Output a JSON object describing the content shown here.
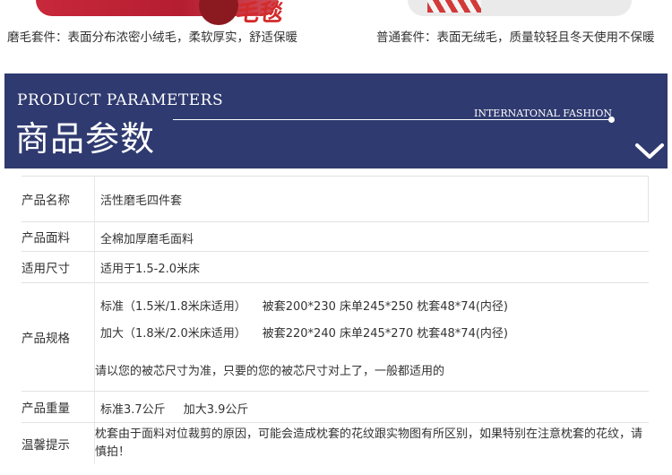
{
  "captions": {
    "left": "磨毛套件：表面分布浓密小绒毛，柔软厚实，舒适保暖",
    "right": "普通套件：表面无绒毛，质量较轻且冬天使用不保暖"
  },
  "banner": {
    "title_en": "PRODUCT PARAMETERS",
    "title_cn": "商品参数",
    "tag": "INTERNATONAL FASHION"
  },
  "params": [
    {
      "label": "产品名称",
      "value": "活性磨毛四件套"
    },
    {
      "label": "产品面料",
      "value": "全棉加厚磨毛面料"
    },
    {
      "label": "适用尺寸",
      "value": "适用于1.5-2.0米床"
    },
    {
      "label": "产品规格",
      "spec_a_name": "标准（1.5米/1.8米床适用）",
      "spec_a_size": "被套200*230 床单245*250 枕套48*74(内径)",
      "spec_b_name": "加大（1.8米/2.0米床适用）",
      "spec_b_size": "被套220*240 床单245*270 枕套48*74(内径)",
      "note": "请以您的被芯尺寸为准，只要的您的被芯尺寸对上了，一般都适用的"
    },
    {
      "label": "产品重量",
      "std": "标准3.7公斤",
      "large": "加大3.9公斤"
    },
    {
      "label": "温馨提示",
      "value": "枕套由于面料对位裁剪的原因，可能会造成枕套的花纹跟实物图有所区别，如果特别在注意枕套的花纹，请慎拍！"
    }
  ],
  "colors": {
    "banner_bg": "#2f3a70",
    "border": "#e2e2e2"
  }
}
